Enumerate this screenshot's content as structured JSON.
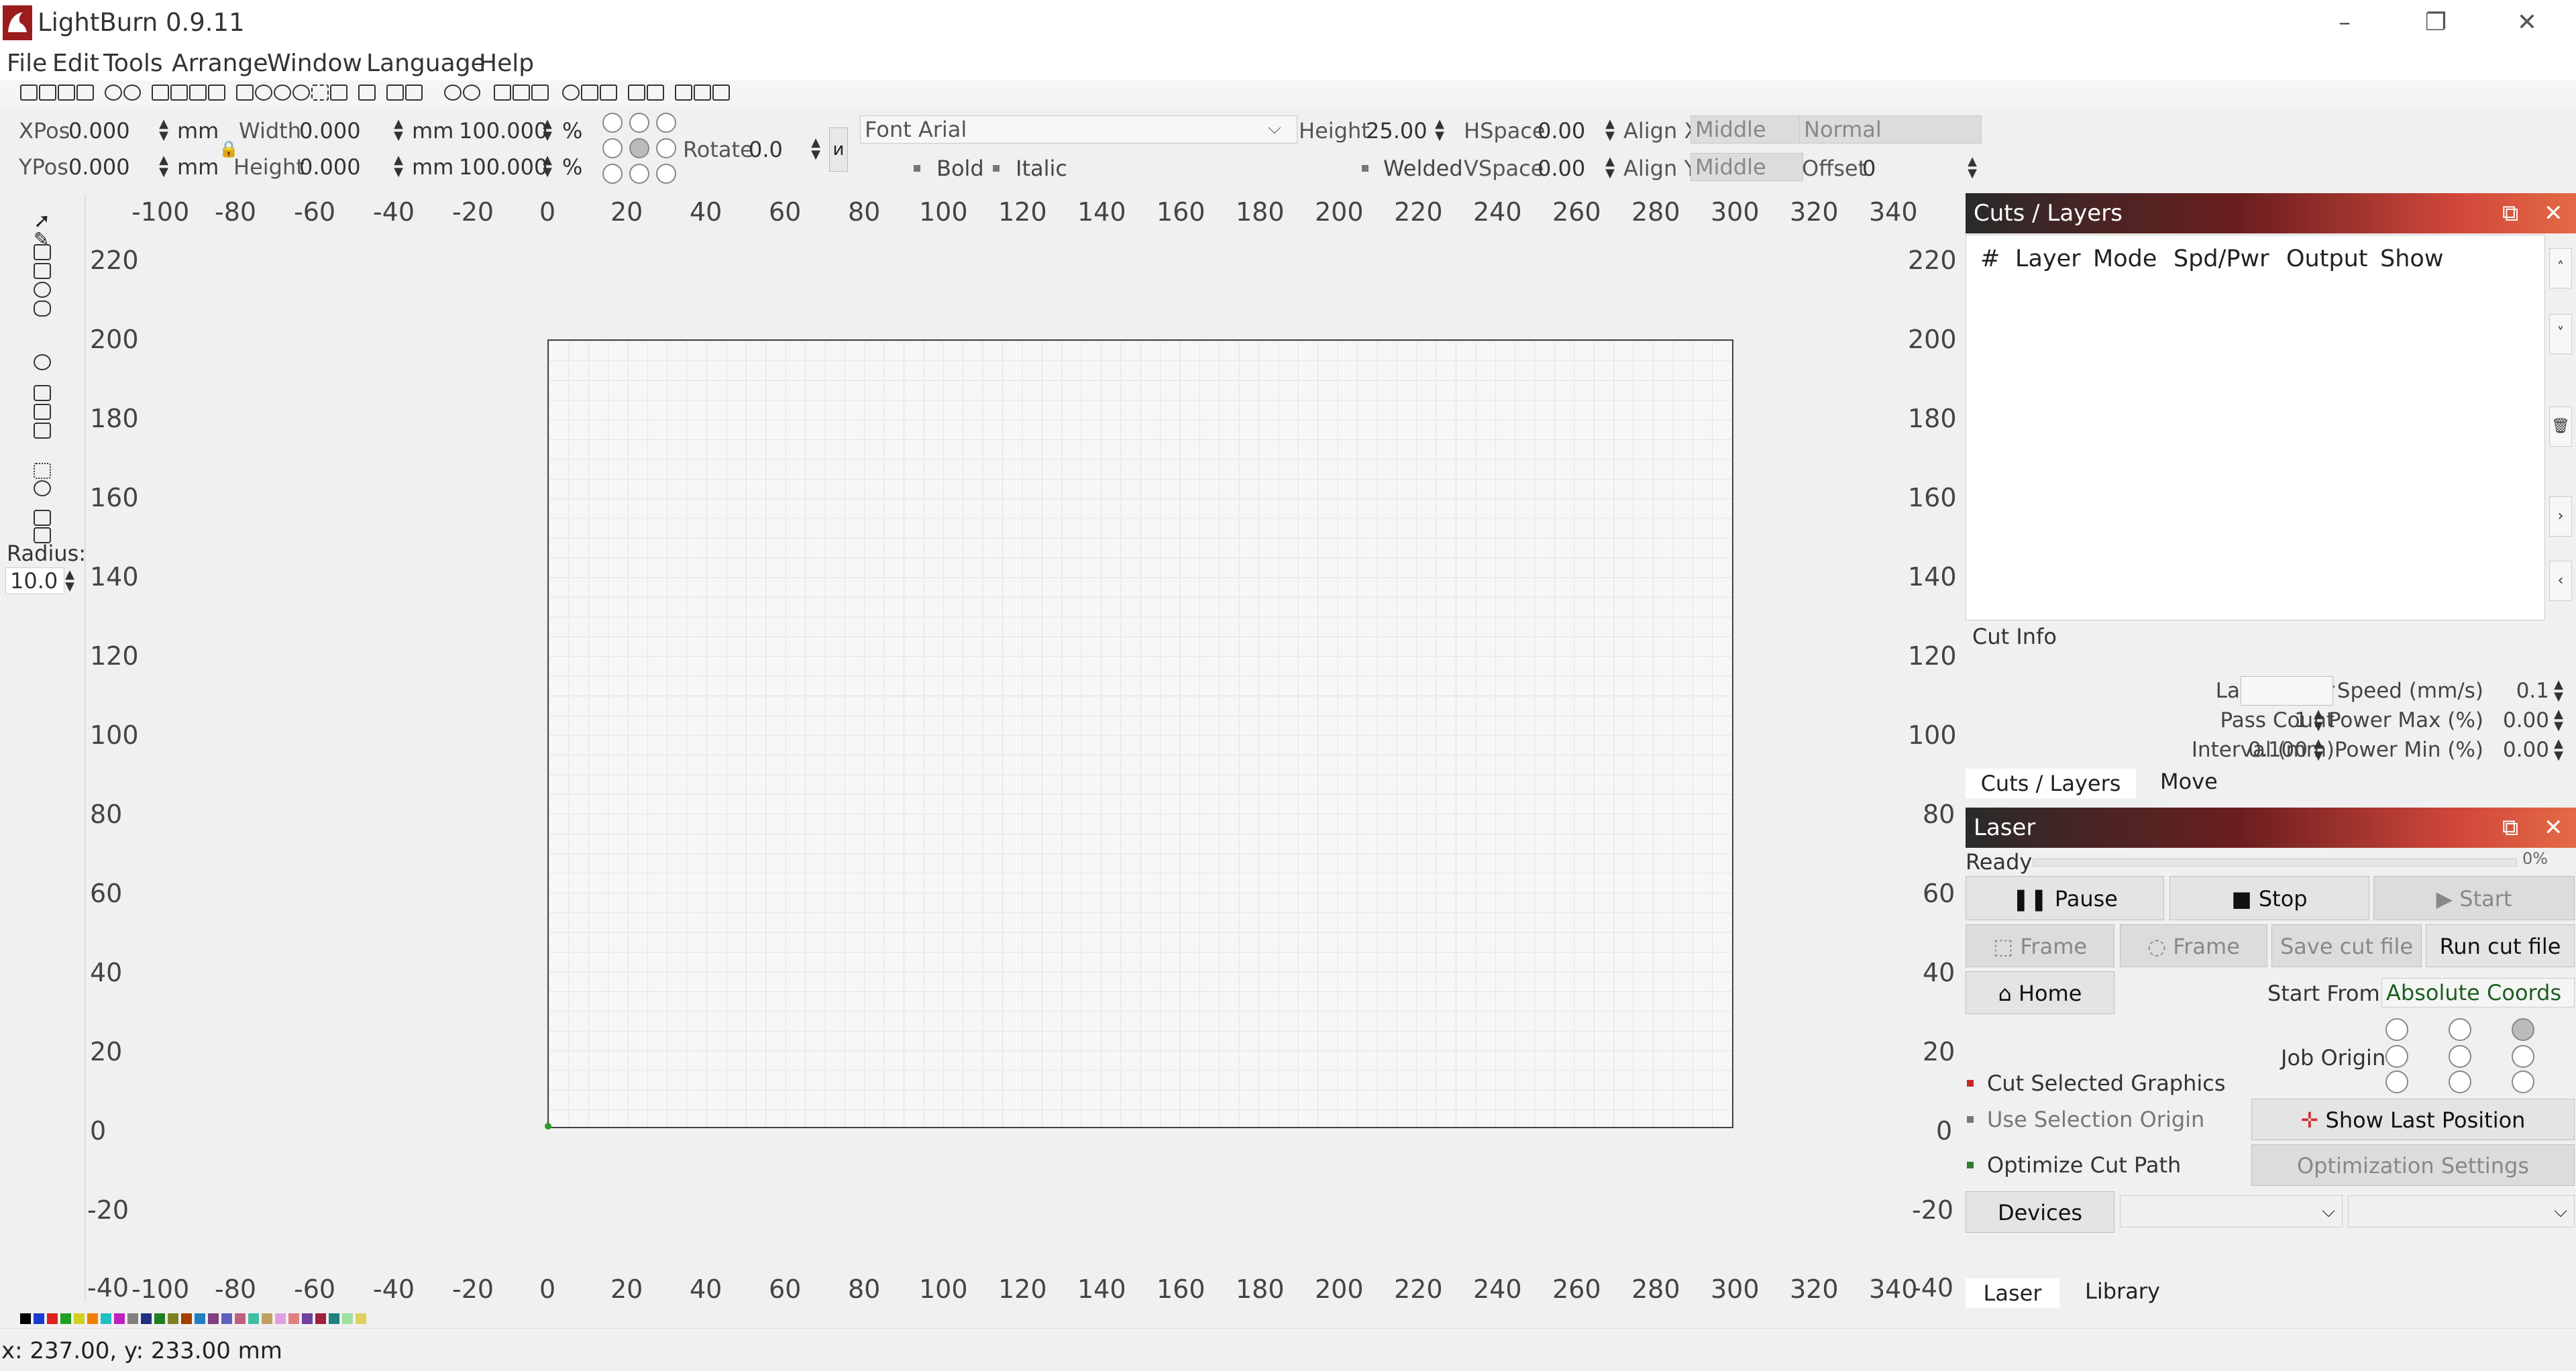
{
  "app": {
    "title": "LightBurn 0.9.11"
  },
  "window": {
    "minimize": "–",
    "restore": "❐",
    "close": "✕"
  },
  "menu": [
    "File",
    "Edit",
    "Tools",
    "Arrange",
    "Window",
    "Language",
    "Help"
  ],
  "toolbar": {
    "xpos_label": "XPos",
    "xpos_value": "0.000",
    "ypos_label": "YPos",
    "ypos_value": "0.000",
    "unit": "mm",
    "width_label": "Width",
    "width_value": "0.000",
    "height_label": "Height",
    "height_value": "0.000",
    "scale_w": "100.000",
    "scale_h": "100.000",
    "percent": "%",
    "rotate_label": "Rotate",
    "rotate_value": "0.0",
    "font_label": "Font",
    "font_value": "Arial",
    "text_height_label": "Height",
    "text_height_value": "25.00",
    "hspace_label": "HSpace",
    "hspace_value": "0.00",
    "vspace_label": "VSpace",
    "vspace_value": "0.00",
    "alignx_label": "Align X",
    "alignx_value": "Middle",
    "aligny_label": "Align Y",
    "aligny_value": "Middle",
    "mode_value": "Normal",
    "offset_label": "Offset",
    "offset_value": "0",
    "bold": "Bold",
    "italic": "Italic",
    "welded": "Welded"
  },
  "left_tools": {
    "radius_label": "Radius:",
    "radius_value": "10.0"
  },
  "rulers": {
    "x_ticks": [
      "-100",
      "-80",
      "-60",
      "-40",
      "-20",
      "0",
      "20",
      "40",
      "60",
      "80",
      "100",
      "120",
      "140",
      "160",
      "180",
      "200",
      "220",
      "240",
      "260",
      "280",
      "300",
      "320",
      "340"
    ],
    "y_ticks": [
      "220",
      "200",
      "180",
      "160",
      "140",
      "120",
      "100",
      "80",
      "60",
      "40",
      "20",
      "0",
      "-20",
      "-40"
    ]
  },
  "palette": [
    "#000000",
    "#1a3bd1",
    "#e02020",
    "#20a020",
    "#d0d020",
    "#f08000",
    "#20c0c0",
    "#c020c0",
    "#808080",
    "#203080",
    "#208020",
    "#808020",
    "#a04000",
    "#2080c0",
    "#804080",
    "#6060c0",
    "#c06080",
    "#40c0a0",
    "#c0a060",
    "#e0a0e0",
    "#e08080",
    "#7040a0",
    "#a02040",
    "#208080",
    "#a0e0a0",
    "#e0d060"
  ],
  "status": {
    "text": "x: 237.00, y: 233.00 mm"
  },
  "cuts_panel": {
    "title": "Cuts / Layers",
    "columns": [
      "#",
      "Layer",
      "Mode",
      "Spd/Pwr",
      "Output",
      "Show"
    ],
    "cut_info_label": "Cut Info",
    "layer_color_label": "Layer Color",
    "speed_label": "Speed (mm/s)",
    "speed_value": "0.1",
    "pass_count_label": "Pass Count",
    "pass_count_value": "1",
    "power_max_label": "Power Max (%)",
    "power_max_value": "0.00",
    "interval_label": "Interval (mm)",
    "interval_value": "0.100",
    "power_min_label": "Power Min (%)",
    "power_min_value": "0.00",
    "tabs": [
      "Cuts / Layers",
      "Move"
    ]
  },
  "laser_panel": {
    "title": "Laser",
    "status": "Ready",
    "progress_text": "0%",
    "progress": 0,
    "pause": "Pause",
    "stop": "Stop",
    "start": "Start",
    "frame1": "Frame",
    "frame2": "Frame",
    "save_cut_file": "Save cut file",
    "run_cut_file": "Run cut file",
    "home": "Home",
    "start_from_label": "Start From:",
    "start_from_value": "Absolute Coords",
    "job_origin_label": "Job Origin",
    "cut_selected": "Cut Selected Graphics",
    "use_selection_origin": "Use Selection Origin",
    "show_last_position": "Show Last Position",
    "optimize_cut_path": "Optimize Cut Path",
    "optimization_settings": "Optimization Settings",
    "devices": "Devices",
    "tabs": [
      "Laser",
      "Library"
    ]
  }
}
